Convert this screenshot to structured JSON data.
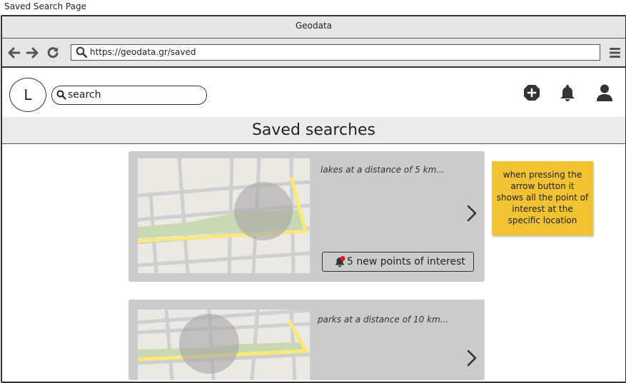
{
  "page_caption": "Saved Search Page",
  "browser": {
    "title": "Geodata",
    "url": "https://geodata.gr/saved"
  },
  "header": {
    "logo_letter": "L",
    "search_placeholder": "search"
  },
  "section_title": "Saved searches",
  "saved_searches": [
    {
      "query": "lakes at a distance of 5 km...",
      "poi_label": "5 new points of interest"
    },
    {
      "query": "parks at a distance of 10 km..."
    }
  ],
  "note": "when pressing the arrow button it shows all the point of interest at the specific location",
  "colors": {
    "card": "#cbcbcb",
    "sticky_note": "#f1c232",
    "notification_dot": "#e0191f",
    "road_yellow": "#fbe77a",
    "park_green": "#c8d8b0"
  },
  "icons": [
    "back-arrow-icon",
    "forward-arrow-icon",
    "reload-icon",
    "search-icon",
    "menu-icon",
    "add-icon",
    "bell-icon",
    "user-icon",
    "chevron-right-icon"
  ]
}
